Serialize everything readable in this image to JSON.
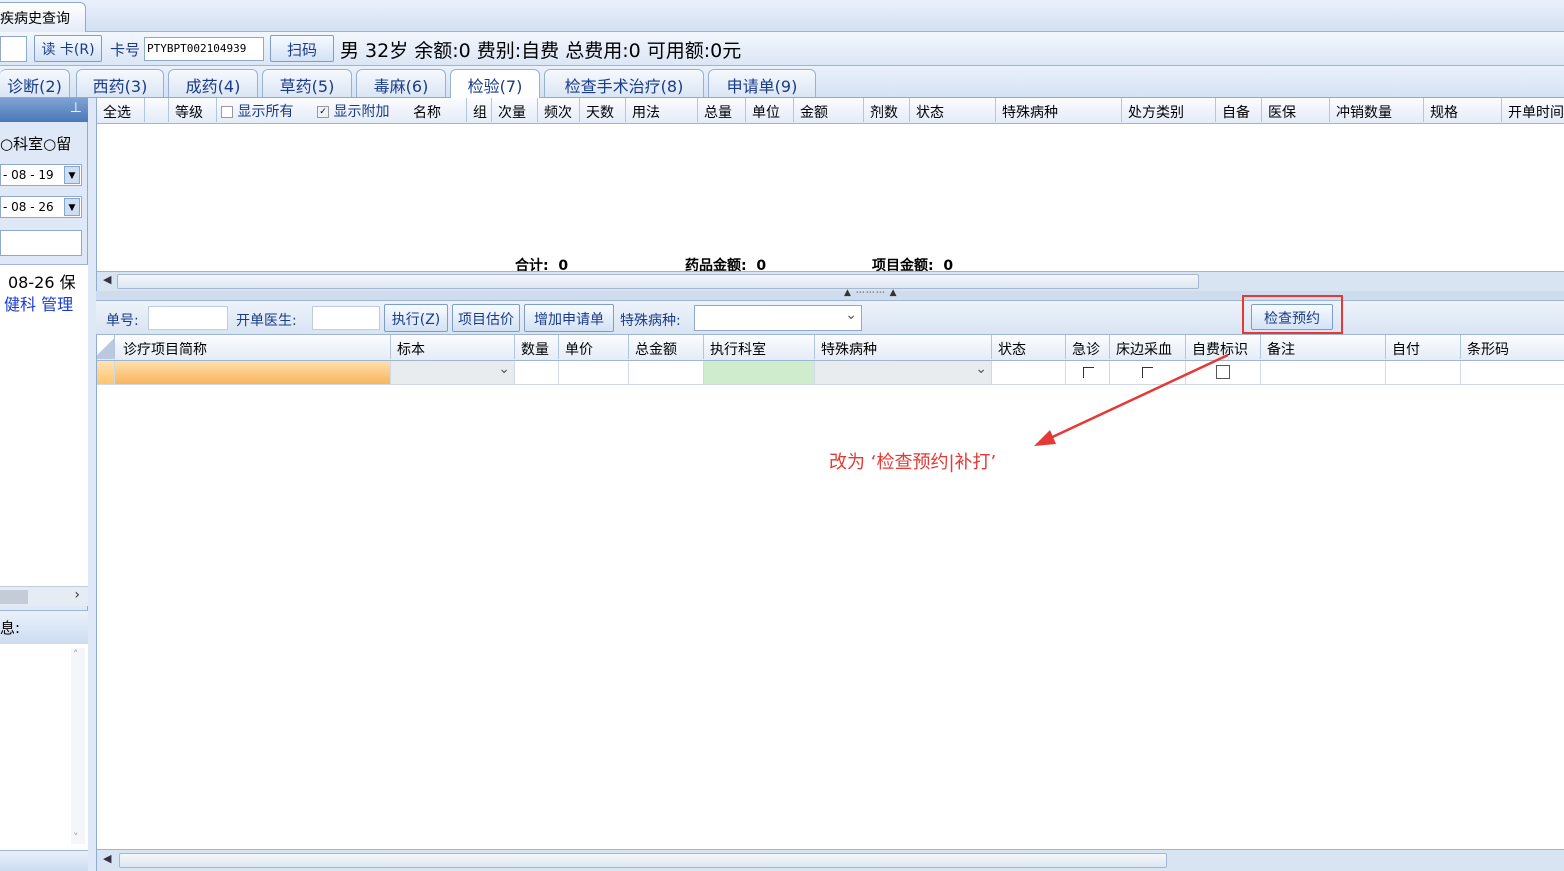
{
  "window": {
    "history_tab": "疾病史查询"
  },
  "patient_bar": {
    "read_card_button": "读 卡(R)",
    "card_label": "卡号",
    "card_number": "PTYBPT002104939",
    "scan_button": "扫码",
    "info": "男  32岁  余额:0  费别:自费  总费用:0  可用额:0元"
  },
  "tabs": [
    {
      "label": "诊断(2)"
    },
    {
      "label": "西药(3)"
    },
    {
      "label": "成药(4)"
    },
    {
      "label": "草药(5)"
    },
    {
      "label": "毒麻(6)"
    },
    {
      "label": "检验(7)"
    },
    {
      "label": "检查手术治疗(8)"
    },
    {
      "label": "申请单(9)"
    }
  ],
  "left_panel": {
    "pin_icon": "pin-icon",
    "radio_dept": "科室",
    "radio_stay": "留",
    "date_from": "- 08 - 19",
    "date_to": "- 08 - 26",
    "record_date": "08-26",
    "record_tag": "保",
    "record_dept": "健科",
    "record_manage": "管理",
    "info_label": "息:"
  },
  "top_grid": {
    "select_all": "全选",
    "show_all": "显示所有",
    "show_extra": "显示附加",
    "columns": [
      "等级",
      "名称",
      "组",
      "次量",
      "频次",
      "天数",
      "用法",
      "总量",
      "单位",
      "金额",
      "剂数",
      "状态",
      "特殊病种",
      "处方类别",
      "自备",
      "医保",
      "冲销数量",
      "规格",
      "开单时间"
    ],
    "total_label": "合计:",
    "total_value": "0",
    "drug_amount_label": "药品金额:",
    "drug_amount_value": "0",
    "item_amount_label": "项目金额:",
    "item_amount_value": "0"
  },
  "order_toolbar": {
    "order_no_label": "单号:",
    "doctor_label": "开单医生:",
    "execute_button": "执行(Z)",
    "estimate_button": "项目估价",
    "add_request_button": "增加申请单",
    "special_label": "特殊病种:",
    "exam_booking_button": "检查预约"
  },
  "bottom_grid": {
    "columns": [
      "诊疗项目简称",
      "标本",
      "数量",
      "单价",
      "总金额",
      "执行科室",
      "特殊病种",
      "状态",
      "急诊",
      "床边采血",
      "自费标识",
      "备注",
      "自付",
      "条形码"
    ]
  },
  "annotation": {
    "text": "改为 ‘检查预约|补打’",
    "color": "#e53935"
  }
}
